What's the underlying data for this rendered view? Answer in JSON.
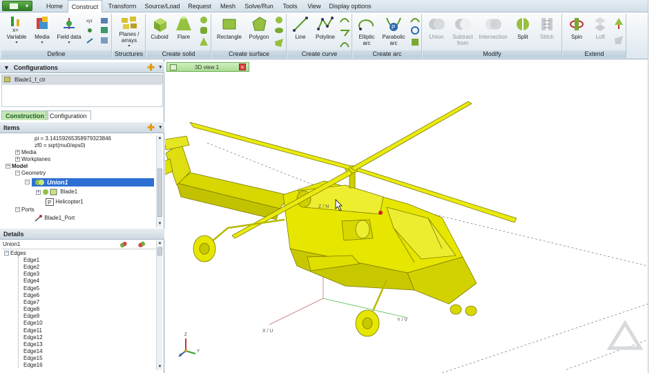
{
  "tabs": [
    "Home",
    "Construct",
    "Transform",
    "Source/Load",
    "Request",
    "Mesh",
    "Solve/Run",
    "Tools",
    "View",
    "Display options"
  ],
  "active_tab": "Construct",
  "ribbon": {
    "groups": [
      {
        "caption": "Define",
        "buttons": [
          "Variable",
          "Media",
          "Field data"
        ]
      },
      {
        "caption": "Structures",
        "buttons": [
          "Planes / arrays"
        ]
      },
      {
        "caption": "Create solid",
        "buttons": [
          "Cuboid",
          "Flare"
        ]
      },
      {
        "caption": "Create surface",
        "buttons": [
          "Rectangle",
          "Polygon"
        ]
      },
      {
        "caption": "Create curve",
        "buttons": [
          "Line",
          "Polyline"
        ]
      },
      {
        "caption": "Create arc",
        "buttons": [
          "Elliptic arc",
          "Parabolic arc"
        ]
      },
      {
        "caption": "Modify",
        "buttons": [
          "Union",
          "Subtract from",
          "Intersection",
          "Split",
          "Stitch"
        ]
      },
      {
        "caption": "Extend",
        "buttons": [
          "Spin",
          "Loft"
        ]
      }
    ]
  },
  "configurations": {
    "title": "Configurations",
    "item": "Blade1_f_ctr"
  },
  "panel_tabs": [
    "Construction",
    "Configuration"
  ],
  "items": {
    "title": "Items",
    "lines": [
      "pi = 3.14159265358979323846",
      "zf0 = sqrt(mu0/eps0)",
      "Media",
      "Workplanes",
      "Model",
      "Geometry",
      "Union1",
      "Blade1",
      "Helicopter1",
      "Ports",
      "Blade1_Port"
    ]
  },
  "details": {
    "title": "Details",
    "name": "Union1",
    "group": "Edges",
    "edges": [
      "Edge1",
      "Edge2",
      "Edge3",
      "Edge4",
      "Edge5",
      "Edge6",
      "Edge7",
      "Edge8",
      "Edge9",
      "Edge10",
      "Edge11",
      "Edge12",
      "Edge13",
      "Edge14",
      "Edge15",
      "Edge16"
    ]
  },
  "view": {
    "tab": "3D view 1",
    "axis_labels": {
      "x": "X / U",
      "y": "Y / V",
      "z": "Z / N"
    },
    "triad": {
      "x": "X",
      "y": "Y",
      "z": "Z"
    }
  },
  "colors": {
    "model": "#e6e600",
    "accent": "#2d6fd3",
    "active_view": "#a9dc93"
  }
}
